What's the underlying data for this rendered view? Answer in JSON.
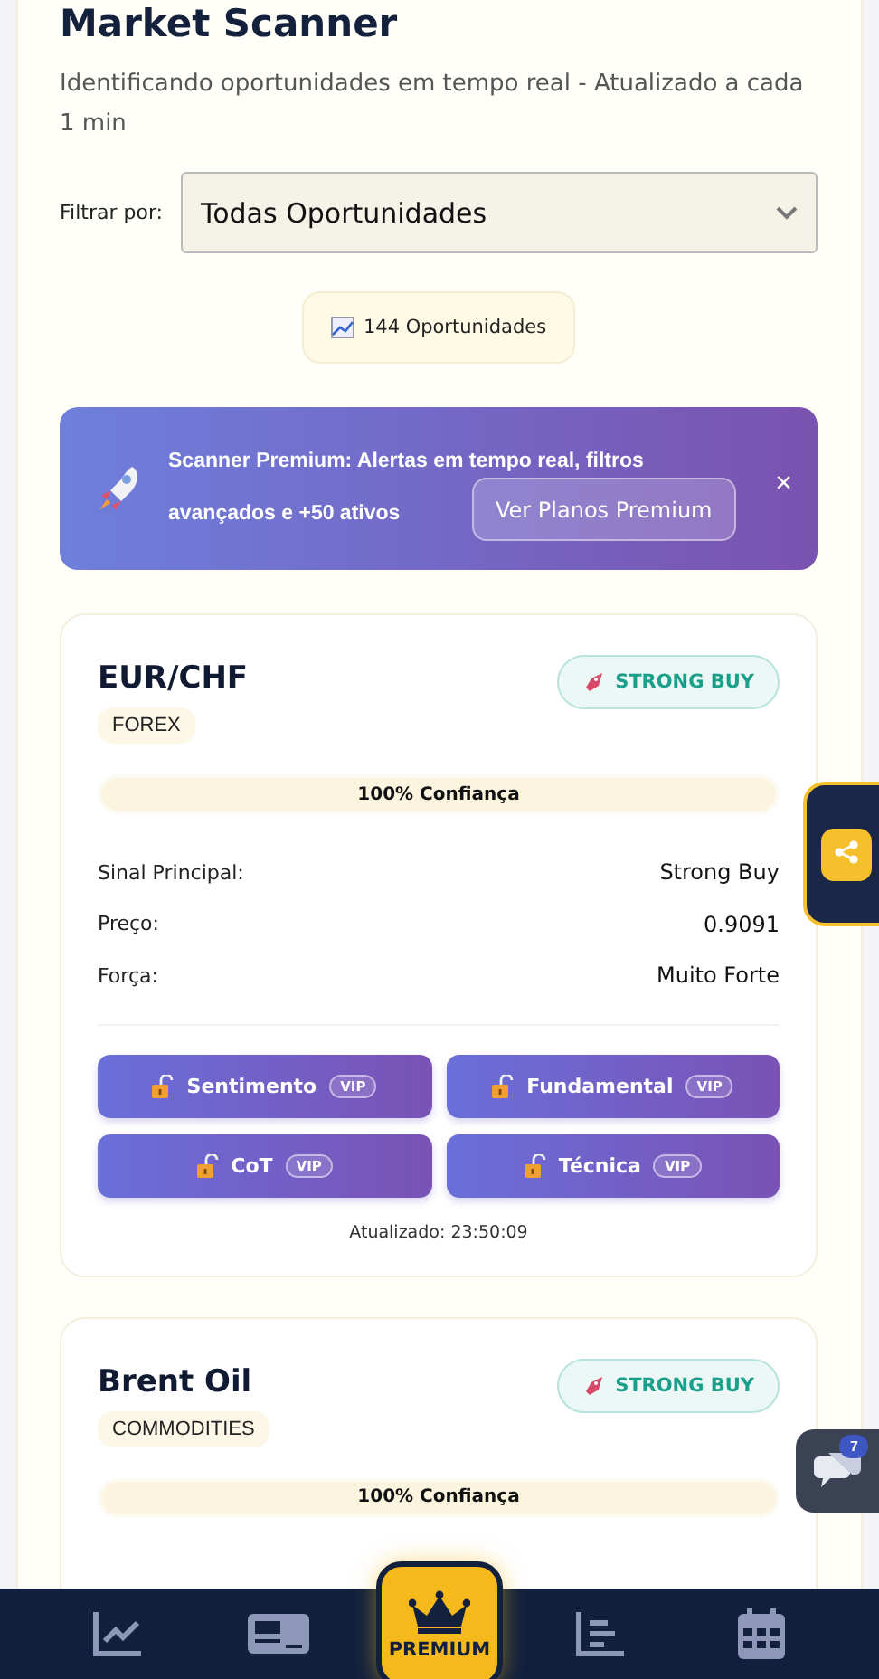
{
  "header": {
    "title": "Market Scanner",
    "subtitle": "Identificando oportunidades em tempo real - Atualizado a cada 1 min"
  },
  "filter": {
    "label": "Filtrar por:",
    "value": "Todas Oportunidades"
  },
  "count_badge": {
    "text": "144 Oportunidades"
  },
  "banner": {
    "lines": [
      "Scanner Premium: Alertas em tempo real, filtros",
      "avançados e +50 ativos"
    ],
    "button": "Ver Planos Premium",
    "close": "×"
  },
  "cards": [
    {
      "asset": "EUR/CHF",
      "category": "FOREX",
      "signal": "STRONG BUY",
      "level": 1,
      "confidence": "100% Confiança",
      "rows": [
        {
          "label": "Sinal Principal:",
          "value": "Strong Buy"
        },
        {
          "label": "Preço:",
          "value": "0.9091"
        },
        {
          "label": "Força:",
          "value": "Muito Forte"
        }
      ],
      "buttons": [
        {
          "label": "Sentimento",
          "badge": "VIP"
        },
        {
          "label": "Fundamental",
          "badge": "VIP"
        },
        {
          "label": "CoT",
          "badge": "VIP"
        },
        {
          "label": "Técnica",
          "badge": "VIP"
        }
      ],
      "updated": "Atualizado: 23:50:09"
    },
    {
      "asset": "Brent Oil",
      "category": "COMMODITIES",
      "signal": "STRONG BUY",
      "level": 1,
      "confidence": "100% Confiança"
    }
  ],
  "chat": {
    "badge": "7"
  },
  "nav": [
    {
      "kind": "chart"
    },
    {
      "kind": "card"
    },
    {
      "kind": "premium",
      "label": "PREMIUM"
    },
    {
      "kind": "list"
    },
    {
      "kind": "calendar"
    }
  ]
}
